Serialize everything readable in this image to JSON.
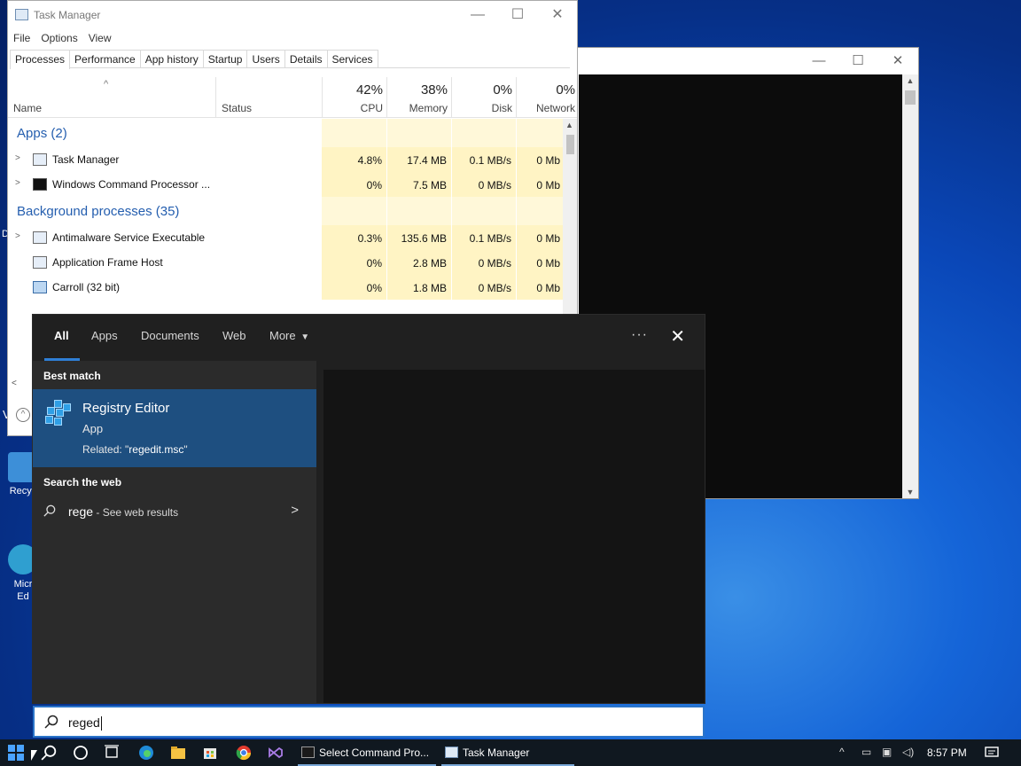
{
  "desktop": {
    "icons": [
      {
        "label": "Recyc",
        "color": "#3d8fd8"
      },
      {
        "label": "Micr\nEd",
        "color": "#2f9fd0"
      }
    ],
    "edge_letters": [
      "D",
      "V"
    ]
  },
  "cmd_window": {
    "controls": [
      "—",
      "☐",
      "✕"
    ]
  },
  "task_manager": {
    "title": "Task Manager",
    "controls": [
      "—",
      "☐",
      "✕"
    ],
    "menu": [
      "File",
      "Options",
      "View"
    ],
    "tabs": [
      "Processes",
      "Performance",
      "App history",
      "Startup",
      "Users",
      "Details",
      "Services"
    ],
    "active_tab": "Processes",
    "columns": {
      "name": "Name",
      "status": "Status",
      "cpu": {
        "pct": "42%",
        "label": "CPU"
      },
      "memory": {
        "pct": "38%",
        "label": "Memory"
      },
      "disk": {
        "pct": "0%",
        "label": "Disk"
      },
      "network": {
        "pct": "0%",
        "label": "Network"
      }
    },
    "groups": [
      {
        "title": "Apps (2)",
        "rows": [
          {
            "name": "Task Manager",
            "cpu": "4.8%",
            "memory": "17.4 MB",
            "disk": "0.1 MB/s",
            "network": "0 Mb",
            "icon": "task-manager-icon",
            "expandable": true
          },
          {
            "name": "Windows Command Processor ...",
            "cpu": "0%",
            "memory": "7.5 MB",
            "disk": "0 MB/s",
            "network": "0 Mb",
            "icon": "cmd-icon",
            "expandable": true
          }
        ]
      },
      {
        "title": "Background processes (35)",
        "rows": [
          {
            "name": "Antimalware Service Executable",
            "cpu": "0.3%",
            "memory": "135.6 MB",
            "disk": "0.1 MB/s",
            "network": "0 Mb",
            "icon": "process-icon",
            "expandable": true
          },
          {
            "name": "Application Frame Host",
            "cpu": "0%",
            "memory": "2.8 MB",
            "disk": "0 MB/s",
            "network": "0 Mb",
            "icon": "process-icon",
            "expandable": false
          },
          {
            "name": "Carroll (32 bit)",
            "cpu": "0%",
            "memory": "1.8 MB",
            "disk": "0 MB/s",
            "network": "0 Mb",
            "icon": "monitor-icon",
            "expandable": false
          }
        ]
      }
    ]
  },
  "search": {
    "tabs": [
      "All",
      "Apps",
      "Documents",
      "Web",
      "More"
    ],
    "active_tab": "All",
    "more_icon": "caret-down-icon",
    "best_match_heading": "Best match",
    "best_match": {
      "title": "Registry Editor",
      "type": "App",
      "related_prefix": "Related: \"",
      "related_bold": "regedit.msc",
      "related_suffix": "\""
    },
    "web_heading": "Search the web",
    "web_result": {
      "query": "rege",
      "suffix": " - See web results"
    },
    "query": "reged"
  },
  "taskbar": {
    "apps": [
      {
        "label": "Select Command Pro...",
        "icon": "cmd-icon"
      },
      {
        "label": "Task Manager",
        "icon": "task-manager-icon"
      }
    ],
    "clock": "8:57 PM",
    "tray_icons": [
      "chevron-up-icon",
      "tablet-icon",
      "network-icon",
      "volume-icon"
    ]
  },
  "colors": {
    "accent": "#2f7fd6",
    "best_match_bg": "#1e4f80",
    "group_title": "#245eaf",
    "cell_highlight": "#fff4c4"
  }
}
